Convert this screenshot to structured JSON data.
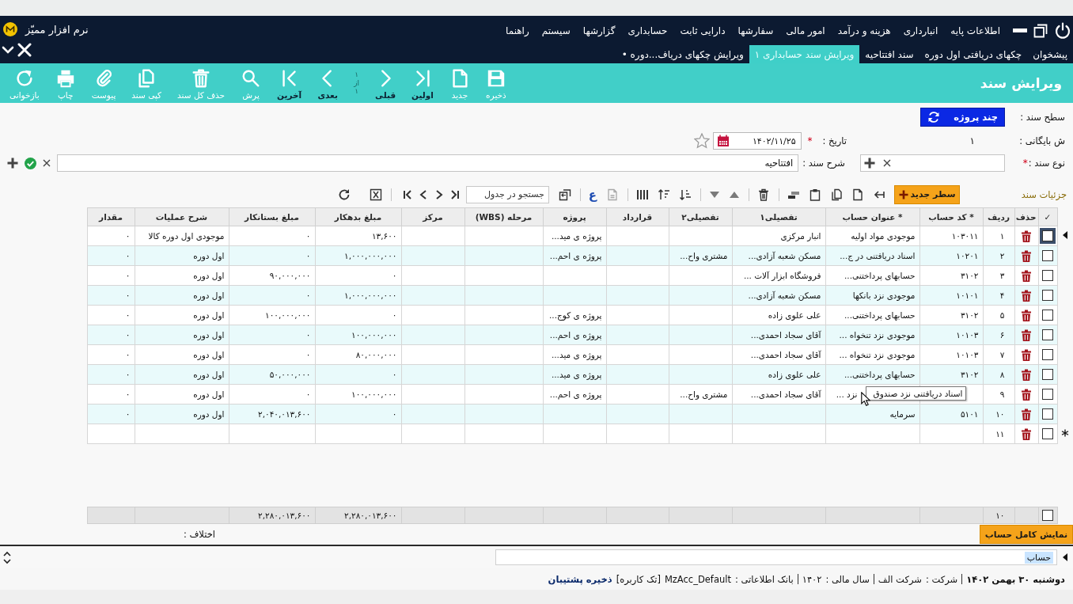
{
  "header": {
    "app_name": "نرم افزار ممیّز",
    "menu": [
      "اطلاعات پایه",
      "انبارداری",
      "هزینه و درآمد",
      "امور مالی",
      "سفارشها",
      "دارایی ثابت",
      "حسابداری",
      "گزارشها",
      "سیستم",
      "راهنما"
    ],
    "tabs": [
      {
        "label": "پیشخوان",
        "selected": false
      },
      {
        "label": "چکهای دریافتی اول دوره",
        "selected": false
      },
      {
        "label": "سند افتتاحیه",
        "selected": false
      },
      {
        "label": "ویرایش سند حسابداری ۱",
        "selected": true
      },
      {
        "label": "ویرایش چکهای دریاف...دوره •",
        "selected": false
      }
    ]
  },
  "toolbar": {
    "title": "ویرایش سند",
    "items": [
      {
        "kind": "action",
        "label": "ذخیره"
      },
      {
        "kind": "action",
        "label": "جدید"
      },
      {
        "kind": "nav",
        "label": "اولین"
      },
      {
        "kind": "nav",
        "label": "قبلی"
      },
      {
        "kind": "pager",
        "lines": [
          "۱",
          "از",
          "۱"
        ]
      },
      {
        "kind": "nav",
        "label": "بعدی"
      },
      {
        "kind": "nav",
        "label": "آخرین"
      },
      {
        "kind": "action",
        "label": "پرش"
      },
      {
        "kind": "action",
        "label": "حذف کل سند"
      },
      {
        "kind": "action",
        "label": "کپی سند"
      },
      {
        "kind": "action",
        "label": "پیوست"
      },
      {
        "kind": "action",
        "label": "چاپ"
      },
      {
        "kind": "action",
        "label": "بازخوانی"
      }
    ]
  },
  "form": {
    "level": {
      "label": "سطح سند :",
      "button": "چند پروژه"
    },
    "archive": {
      "label": "ش بایگانی :",
      "value": "۱"
    },
    "date": {
      "label": "تاریخ :",
      "required_mark": "*",
      "value": "۱۴۰۲/۱۱/۲۵",
      "starred": false
    },
    "doc_type": {
      "label": "نوع سند :",
      "required_mark": "*"
    },
    "description": {
      "label": "شرح سند :",
      "value": "افتتاحیه"
    }
  },
  "details": {
    "title": "جزئیات سند",
    "new_row_button": "سطر جدید",
    "glyph_button": "ع",
    "search": {
      "placeholder": "جستجو در جدول"
    }
  },
  "table": {
    "columns": [
      {
        "label": "✓"
      },
      {
        "label": "حذف"
      },
      {
        "label": "ردیف"
      },
      {
        "label": "* کد حساب"
      },
      {
        "label": "* عنوان حساب"
      },
      {
        "label": "تفصیلی۱"
      },
      {
        "label": "تفصیلی۲"
      },
      {
        "label": "قرارداد"
      },
      {
        "label": "پروژه"
      },
      {
        "label": "مرحله (WBS)"
      },
      {
        "label": "مرکز"
      },
      {
        "label": "مبلغ بدهکار"
      },
      {
        "label": "مبلغ بستانکار"
      },
      {
        "label": "شرح عملیات"
      },
      {
        "label": "مقدار"
      }
    ],
    "rows": [
      {
        "selected": true,
        "checked": false,
        "index": "۱",
        "code": "۱۰۳۰۱۱",
        "title": "موجودی مواد اولیه",
        "detail1": "انبار مرکزی",
        "project": "پروژه ی مید...",
        "debit": "۱۳,۶۰۰",
        "credit": "۰",
        "description": "موجودی اول دوره کالا",
        "quantity": "۰"
      },
      {
        "selected": false,
        "checked": false,
        "index": "۲",
        "code": "۱۰۲۰۱",
        "title": "اسناد دریافتنی در ج...",
        "detail1": "مسکن شعبه آزادی...",
        "detail2": "مشتری واح...",
        "project": "پروژه ی احم...",
        "debit": "۱,۰۰۰,۰۰۰,۰۰۰",
        "credit": "۰",
        "description": "اول دوره",
        "quantity": "۰"
      },
      {
        "selected": false,
        "checked": false,
        "index": "۳",
        "code": "۳۱۰۲",
        "title": "حسابهای پرداختنی...",
        "detail1": "فروشگاه ابزار آلات ...",
        "debit": "۰",
        "credit": "۹۰,۰۰۰,۰۰۰",
        "description": "اول دوره",
        "quantity": "۰"
      },
      {
        "selected": false,
        "checked": false,
        "index": "۴",
        "code": "۱۰۱۰۱",
        "title": "موجودی نزد بانکها",
        "detail1": "مسکن شعبه آزادی...",
        "debit": "۱,۰۰۰,۰۰۰,۰۰۰",
        "credit": "۰",
        "description": "اول دوره",
        "quantity": "۰"
      },
      {
        "selected": false,
        "checked": false,
        "index": "۵",
        "code": "۳۱۰۲",
        "title": "حسابهای پرداختنی...",
        "detail1": "علی علوی زاده",
        "project": "پروژه ی کوج...",
        "debit": "۰",
        "credit": "۱۰۰,۰۰۰,۰۰۰",
        "description": "اول دوره",
        "quantity": "۰"
      },
      {
        "selected": false,
        "checked": false,
        "index": "۶",
        "code": "۱۰۱۰۳",
        "title": "موجودی نزد تنخواه ...",
        "detail1": "آقای سجاد احمدی...",
        "project": "پروژه ی احم...",
        "debit": "۱۰۰,۰۰۰,۰۰۰",
        "credit": "۰",
        "description": "اول دوره",
        "quantity": "۰"
      },
      {
        "selected": false,
        "checked": false,
        "index": "۷",
        "code": "۱۰۱۰۳",
        "title": "موجودی نزد تنخواه ...",
        "detail1": "آقای سجاد احمدی...",
        "project": "پروژه ی مید...",
        "debit": "۸۰,۰۰۰,۰۰۰",
        "credit": "۰",
        "description": "اول دوره",
        "quantity": "۰"
      },
      {
        "selected": false,
        "checked": false,
        "index": "۸",
        "code": "۳۱۰۲",
        "title": "حسابهای پرداختنی...",
        "detail1": "علی علوی زاده",
        "project": "پروژه ی مید...",
        "debit": "۰",
        "credit": "۵۰,۰۰۰,۰۰۰",
        "description": "اول دوره",
        "quantity": "۰"
      },
      {
        "selected": false,
        "checked": false,
        "index": "۹",
        "title": "نزد ...",
        "tooltip": "اسناد دریافتنی نزد صندوق",
        "detail1": "آقای سجاد احمدی...",
        "detail2": "مشتری واح...",
        "project": "پروژه ی احم...",
        "debit": "۱۰۰,۰۰۰,۰۰۰",
        "credit": "۰",
        "description": "اول دوره",
        "quantity": "۰"
      },
      {
        "selected": false,
        "checked": false,
        "index": "۱۰",
        "code": "۵۱۰۱",
        "title": "سرمایه",
        "debit": "۰",
        "credit": "۲,۰۴۰,۰۱۳,۶۰۰",
        "description": "اول دوره",
        "quantity": "۰"
      }
    ],
    "new_row": {
      "index": "۱۱",
      "checked": false
    },
    "totals": {
      "checked": false,
      "count": "۱۰",
      "debit": "۲,۲۸۰,۰۱۳,۶۰۰",
      "credit": "۲,۲۸۰,۰۱۳,۶۰۰"
    }
  },
  "footer": {
    "show_account_button": "نمایش کامل حساب",
    "difference_label": "اختلاف :",
    "account_field": {
      "value": "حساب",
      "highlighted": true
    }
  },
  "status_bar": {
    "date": "دوشنبه ۳۰ بهمن ۱۴۰۲",
    "fields": [
      {
        "label": "شرکت :",
        "value": "شرکت الف"
      },
      {
        "label": "سال مالی :",
        "value": "۱۴۰۲"
      },
      {
        "label": "بانک اطلاعاتی :",
        "value": "MzAcc_Default"
      }
    ],
    "mode": "[تک کاربره]",
    "backup_link": "ذخیره پشتیبان"
  }
}
